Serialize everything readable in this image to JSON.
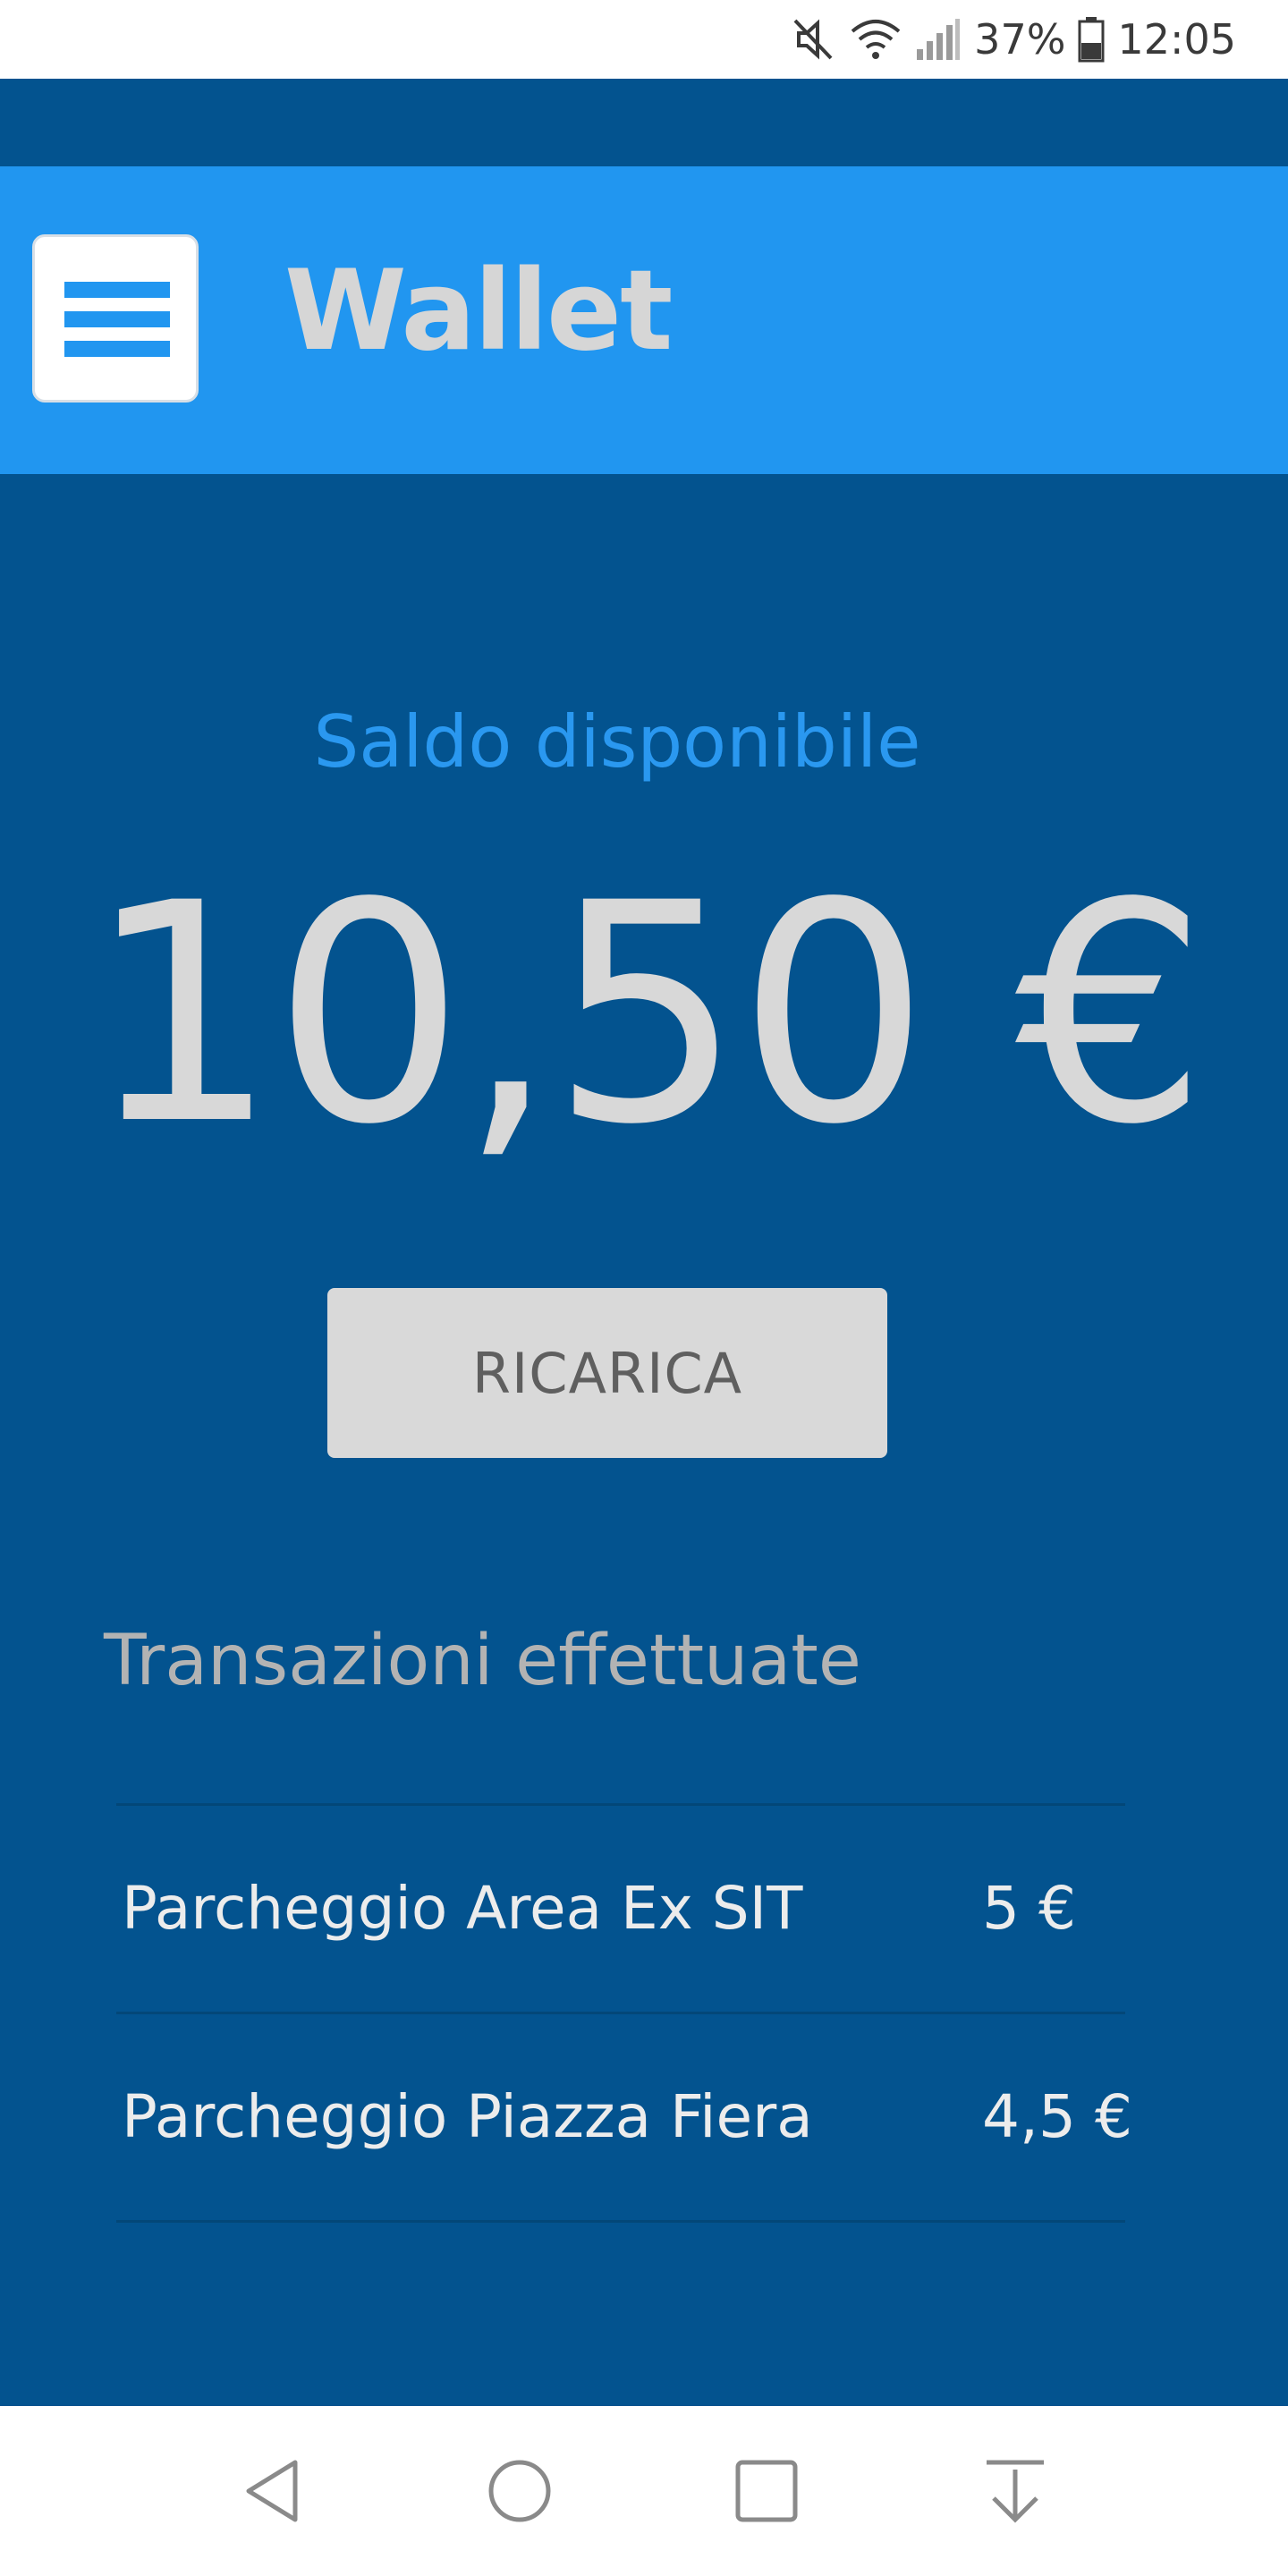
{
  "status_bar": {
    "battery_percent": "37%",
    "time": "12:05",
    "icons": [
      "mute-icon",
      "wifi-icon",
      "signal-icon",
      "battery-icon"
    ]
  },
  "app_bar": {
    "title": "Wallet",
    "menu_icon": "hamburger-menu-icon"
  },
  "balance": {
    "label": "Saldo disponibile",
    "amount": "10,50 €"
  },
  "recharge_button": {
    "label": "RICARICA"
  },
  "transactions": {
    "title": "Transazioni effettuate",
    "items": [
      {
        "name": "Parcheggio Area Ex SIT",
        "amount": "5 €"
      },
      {
        "name": "Parcheggio Piazza Fiera",
        "amount": "4,5 €"
      }
    ]
  },
  "nav_bar": {
    "buttons": [
      "back-icon",
      "home-icon",
      "recents-icon",
      "notification-pull-icon"
    ]
  },
  "colors": {
    "background": "#03538f",
    "app_bar": "#2196f0",
    "accent_label": "#2a98f0",
    "button": "#d9d9d9"
  }
}
